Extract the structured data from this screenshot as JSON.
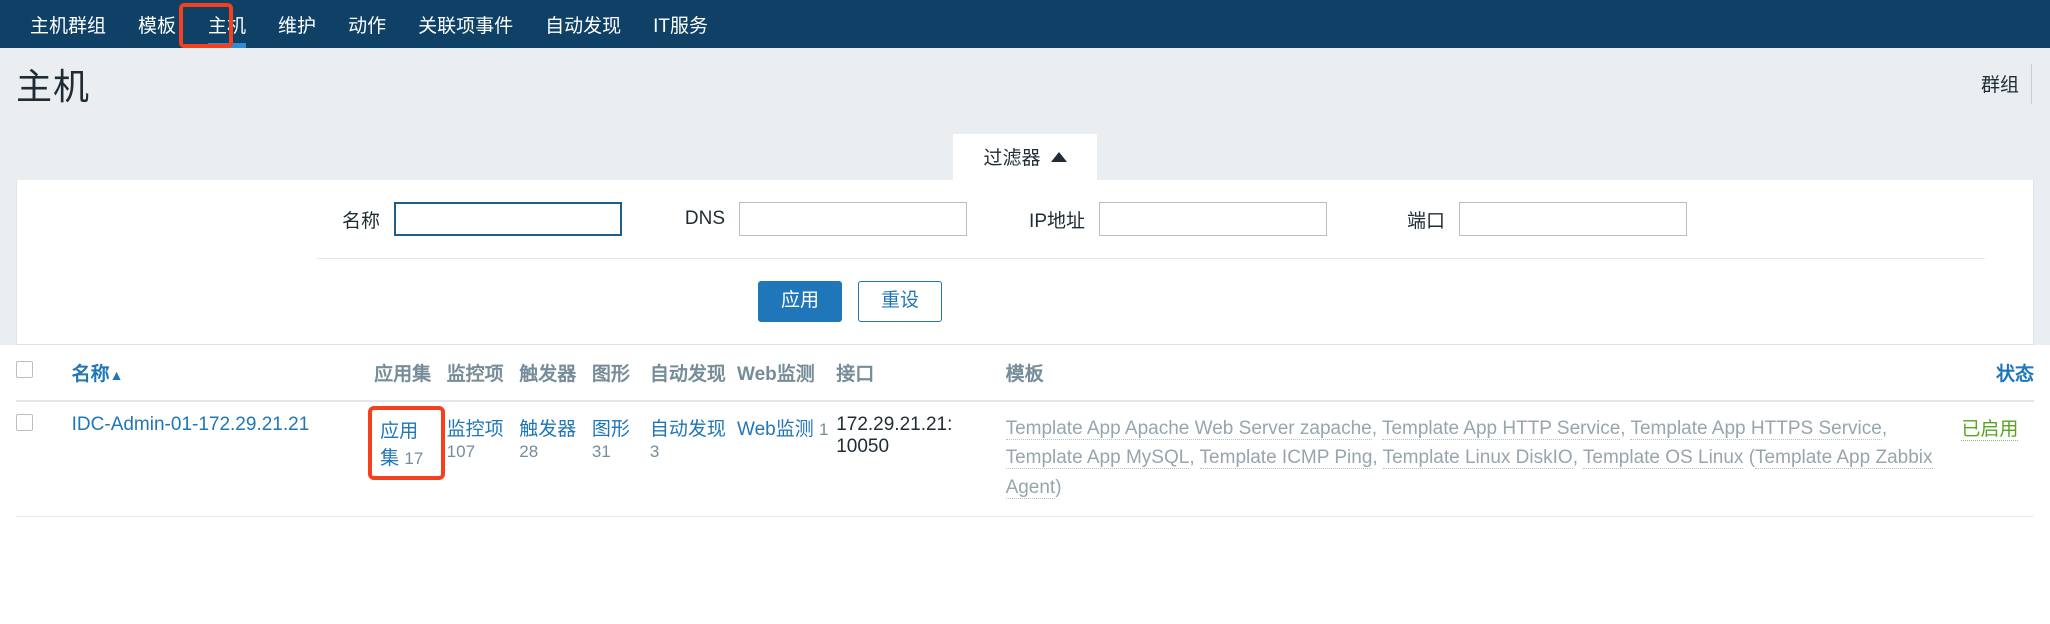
{
  "nav": {
    "items": [
      {
        "label": "主机群组",
        "active": false
      },
      {
        "label": "模板",
        "active": false
      },
      {
        "label": "主机",
        "active": true
      },
      {
        "label": "维护",
        "active": false
      },
      {
        "label": "动作",
        "active": false
      },
      {
        "label": "关联项事件",
        "active": false
      },
      {
        "label": "自动发现",
        "active": false
      },
      {
        "label": "IT服务",
        "active": false
      }
    ]
  },
  "header": {
    "title": "主机",
    "right_label": "群组"
  },
  "filter": {
    "tab_label": "过滤器",
    "tab_icon": "triangle-up-icon",
    "fields": [
      {
        "label": "名称",
        "value": "",
        "placeholder": "",
        "focused": true
      },
      {
        "label": "DNS",
        "value": "",
        "placeholder": "",
        "focused": false
      },
      {
        "label": "IP地址",
        "value": "",
        "placeholder": "",
        "focused": false
      },
      {
        "label": "端口",
        "value": "",
        "placeholder": "",
        "focused": false
      }
    ],
    "apply_label": "应用",
    "reset_label": "重设"
  },
  "table": {
    "columns": [
      {
        "label": "名称",
        "sortable": true,
        "sort_arrow": "▲"
      },
      {
        "label": "应用集",
        "sortable": false
      },
      {
        "label": "监控项",
        "sortable": false
      },
      {
        "label": "触发器",
        "sortable": false
      },
      {
        "label": "图形",
        "sortable": false
      },
      {
        "label": "自动发现",
        "sortable": false
      },
      {
        "label": "Web监测",
        "sortable": false
      },
      {
        "label": "接口",
        "sortable": false
      },
      {
        "label": "模板",
        "sortable": false
      },
      {
        "label": "状态",
        "sortable": true
      }
    ],
    "rows": [
      {
        "selected": false,
        "name": "IDC-Admin-01-172.29.21.21",
        "applications_label": "应用集",
        "applications_count": "17",
        "items_label": "监控项",
        "items_count": "107",
        "triggers_label": "触发器",
        "triggers_count": "28",
        "graphs_label": "图形",
        "graphs_count": "31",
        "discovery_label": "自动发现",
        "discovery_count": "3",
        "web_label": "Web监测",
        "web_count": "1",
        "interface": "172.29.21.21: 10050",
        "templates": [
          "Template App Apache Web Server zapache",
          "Template App HTTP Service",
          "Template App HTTPS Service",
          "Template App MySQL",
          "Template ICMP Ping",
          "Template Linux DiskIO",
          "Template OS Linux"
        ],
        "templates_parenthetical": "Template App Zabbix Agent",
        "status": "已启用"
      }
    ]
  },
  "colors": {
    "nav_bg": "#0f4166",
    "accent": "#1f76b8",
    "link": "#1f76b8",
    "muted": "#97a5ad",
    "status_enabled": "#59a325",
    "highlight_box": "#f4401c",
    "page_bg": "#ebeef1"
  }
}
